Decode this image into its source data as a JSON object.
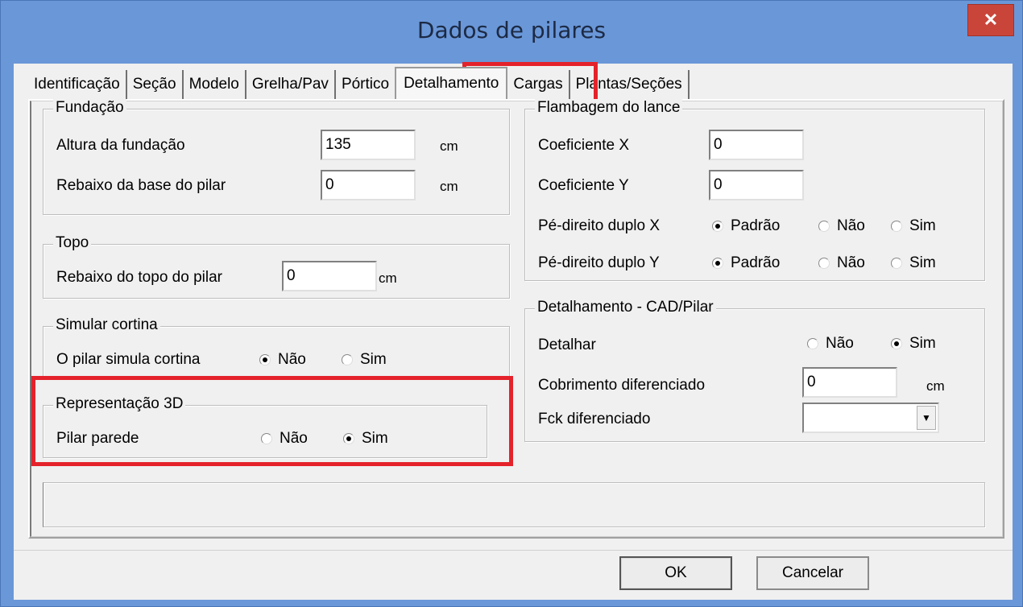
{
  "window": {
    "title": "Dados de pilares",
    "close_glyph": "✕"
  },
  "tabs": [
    {
      "label": "Identificação"
    },
    {
      "label": "Seção"
    },
    {
      "label": "Modelo"
    },
    {
      "label": "Grelha/Pav"
    },
    {
      "label": "Pórtico"
    },
    {
      "label": "Detalhamento",
      "active": true
    },
    {
      "label": "Cargas"
    },
    {
      "label": "Plantas/Seções"
    }
  ],
  "fundacao": {
    "title": "Fundação",
    "altura_label": "Altura da fundação",
    "altura_value": "135",
    "altura_unit": "cm",
    "rebaixo_label": "Rebaixo da base do pilar",
    "rebaixo_value": "0",
    "rebaixo_unit": "cm"
  },
  "topo": {
    "title": "Topo",
    "rebaixo_label": "Rebaixo do topo do pilar",
    "rebaixo_value": "0",
    "rebaixo_unit": "cm"
  },
  "cortina": {
    "title": "Simular cortina",
    "label": "O pilar simula cortina",
    "opt_nao": "Não",
    "opt_sim": "Sim",
    "selected": "Não"
  },
  "rep3d": {
    "title": "Representação 3D",
    "label": "Pilar parede",
    "opt_nao": "Não",
    "opt_sim": "Sim",
    "selected": "Sim"
  },
  "flambagem": {
    "title": "Flambagem do lance",
    "coefx_label": "Coeficiente X",
    "coefx_value": "0",
    "coefy_label": "Coeficiente Y",
    "coefy_value": "0",
    "pdx_label": "Pé-direito duplo X",
    "pdy_label": "Pé-direito duplo Y",
    "opt_padrao": "Padrão",
    "opt_nao": "Não",
    "opt_sim": "Sim",
    "pdx_selected": "Padrão",
    "pdy_selected": "Padrão"
  },
  "cad": {
    "title": "Detalhamento - CAD/Pilar",
    "detalhar_label": "Detalhar",
    "opt_nao": "Não",
    "opt_sim": "Sim",
    "detalhar_selected": "Sim",
    "cobrimento_label": "Cobrimento diferenciado",
    "cobrimento_value": "0",
    "cobrimento_unit": "cm",
    "fck_label": "Fck diferenciado",
    "fck_value": ""
  },
  "buttons": {
    "ok": "OK",
    "cancel": "Cancelar"
  },
  "colors": {
    "highlight": "#e4222b",
    "titlebar": "#6a97d8",
    "close": "#c9453a"
  }
}
